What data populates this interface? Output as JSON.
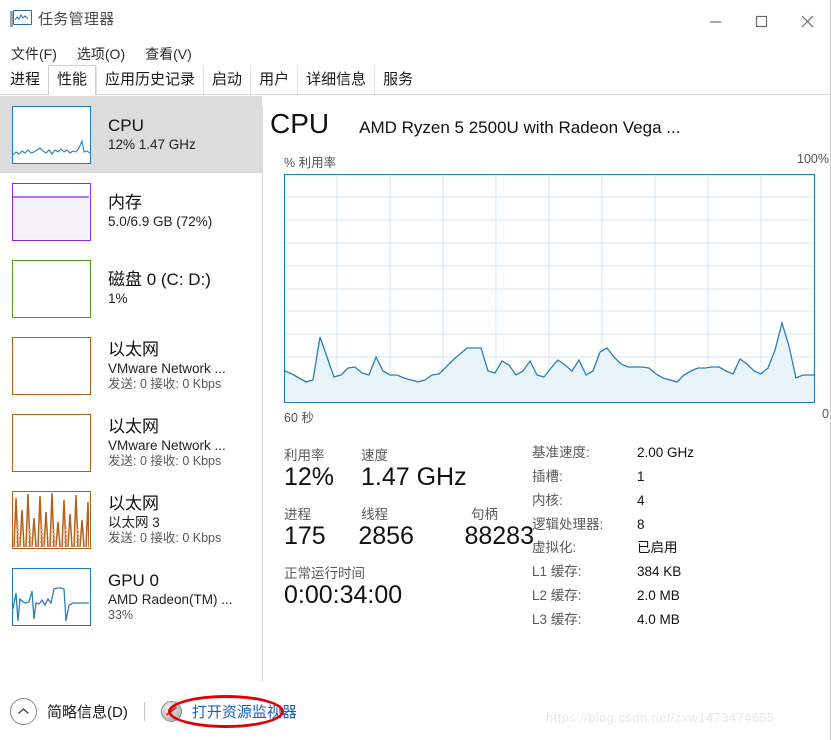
{
  "window": {
    "title": "任务管理器",
    "icon": "task-manager-icon",
    "minimize": "−",
    "maximize": "□",
    "close": "×"
  },
  "menu": {
    "items": [
      {
        "label": "文件(F)",
        "name": "menu-file"
      },
      {
        "label": "选项(O)",
        "name": "menu-options"
      },
      {
        "label": "查看(V)",
        "name": "menu-view"
      }
    ]
  },
  "tabs": {
    "items": [
      {
        "label": "进程",
        "selected": false
      },
      {
        "label": "性能",
        "selected": true
      },
      {
        "label": "应用历史记录",
        "selected": false
      },
      {
        "label": "启动",
        "selected": false
      },
      {
        "label": "用户",
        "selected": false
      },
      {
        "label": "详细信息",
        "selected": false
      },
      {
        "label": "服务",
        "selected": false
      }
    ]
  },
  "sidebar": {
    "items": [
      {
        "name": "sidebar-item-cpu",
        "title": "CPU",
        "sub": "12%  1.47 GHz",
        "sub2": "",
        "selected": true,
        "accent": "#1f7ac0",
        "thumb": "line"
      },
      {
        "name": "sidebar-item-memory",
        "title": "内存",
        "sub": "5.0/6.9 GB (72%)",
        "sub2": "",
        "selected": false,
        "accent": "#8a2be2",
        "thumb": "memory"
      },
      {
        "name": "sidebar-item-disk0",
        "title": "磁盘 0 (C: D:)",
        "sub": "1%",
        "sub2": "",
        "selected": false,
        "accent": "#4f9a21",
        "thumb": "empty"
      },
      {
        "name": "sidebar-item-ethernet-1",
        "title": "以太网",
        "sub": "VMware Network ...",
        "sub2": "发送: 0 接收: 0 Kbps",
        "selected": false,
        "accent": "#b4601a",
        "thumb": "empty"
      },
      {
        "name": "sidebar-item-ethernet-2",
        "title": "以太网",
        "sub": "VMware Network ...",
        "sub2": "发送: 0 接收: 0 Kbps",
        "selected": false,
        "accent": "#b4601a",
        "thumb": "empty"
      },
      {
        "name": "sidebar-item-ethernet-3",
        "title": "以太网",
        "sub": "以太网 3",
        "sub2": "发送: 0 接收: 0 Kbps",
        "selected": false,
        "accent": "#b4601a",
        "thumb": "spikes"
      },
      {
        "name": "sidebar-item-gpu0",
        "title": "GPU 0",
        "sub": "AMD Radeon(TM) ...",
        "sub2": "33%",
        "selected": false,
        "accent": "#1f7ac0",
        "thumb": "gpu"
      }
    ]
  },
  "main": {
    "title": "CPU",
    "model": "AMD Ryzen 5 2500U with Radeon Vega ...",
    "axis_label": "% 利用率",
    "axis_max": "100%",
    "time_left": "60 秒",
    "time_right": "0",
    "stats_left": {
      "row1_labels": [
        "利用率",
        "速度"
      ],
      "row1_values": [
        "12%",
        "1.47 GHz"
      ],
      "row2_labels": [
        "进程",
        "线程",
        "句柄"
      ],
      "row2_values": [
        "175",
        "2856",
        "88283"
      ],
      "uptime_label": "正常运行时间",
      "uptime_value": "0:00:34:00"
    },
    "stats_right": [
      {
        "key": "基准速度:",
        "value": "2.00 GHz"
      },
      {
        "key": "插槽:",
        "value": "1"
      },
      {
        "key": "内核:",
        "value": "4"
      },
      {
        "key": "逻辑处理器:",
        "value": "8"
      },
      {
        "key": "虚拟化:",
        "value": "已启用"
      },
      {
        "key": "L1 缓存:",
        "value": "384 KB"
      },
      {
        "key": "L2 缓存:",
        "value": "2.0 MB"
      },
      {
        "key": "L3 缓存:",
        "value": "4.0 MB"
      }
    ]
  },
  "footer": {
    "fewer_details": "简略信息(D)",
    "resource_monitor": "打开资源监视器",
    "watermark": "https://blog.csdn.net/zxw1473474655"
  },
  "chart_data": {
    "type": "area",
    "title": "CPU 利用率",
    "ylabel": "% 利用率",
    "xlabel": "60 秒",
    "ylim": [
      0,
      100
    ],
    "xlim": [
      60,
      0
    ],
    "grid": true,
    "grid_cols": 10,
    "grid_rows": 10,
    "line_color": "#2a7fb8",
    "fill_color": "#eaf3f9",
    "current_value": 12,
    "values": [
      14,
      13,
      11,
      9,
      10,
      29,
      20,
      13,
      12,
      15,
      16,
      13,
      12,
      20,
      14,
      12,
      12,
      11,
      10,
      9,
      10,
      12,
      13,
      16,
      19,
      22,
      24,
      24,
      24,
      14,
      13,
      18,
      16,
      12,
      14,
      18,
      12,
      11,
      15,
      19,
      16,
      14,
      18,
      12,
      14,
      22,
      24,
      20,
      17,
      16,
      16,
      16,
      15,
      13,
      11,
      10,
      9,
      12,
      14,
      15,
      15,
      16,
      16,
      14,
      13,
      19,
      17,
      14,
      13,
      15,
      22,
      34,
      25,
      12,
      13
    ]
  }
}
